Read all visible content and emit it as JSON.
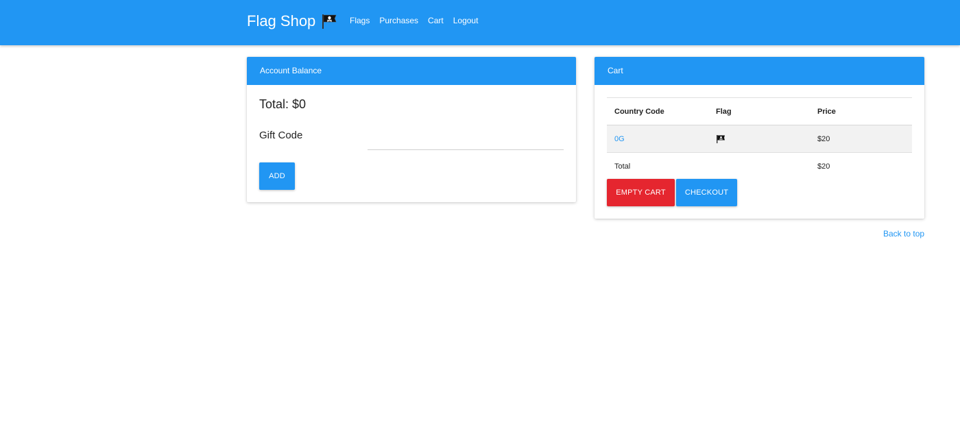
{
  "brand": {
    "title": "Flag Shop",
    "icon": "pirate-flag-icon"
  },
  "nav": {
    "items": [
      {
        "label": "Flags"
      },
      {
        "label": "Purchases"
      },
      {
        "label": "Cart"
      },
      {
        "label": "Logout"
      }
    ]
  },
  "balance": {
    "header": "Account Balance",
    "total_text": "Total: $0",
    "gift_label": "Gift Code",
    "gift_value": "",
    "add_label": "ADD"
  },
  "cart": {
    "header": "Cart",
    "columns": [
      "Country Code",
      "Flag",
      "Price"
    ],
    "items": [
      {
        "code": "0G",
        "flag_icon": "pirate-flag-icon",
        "price": "$20"
      }
    ],
    "total_label": "Total",
    "total_value": "$20",
    "empty_label": "EMPTY CART",
    "checkout_label": "CHECKOUT"
  },
  "footer": {
    "back_to_top": "Back to top"
  },
  "colors": {
    "primary": "#2196f3",
    "danger": "#e5262f",
    "text": "#212121"
  }
}
